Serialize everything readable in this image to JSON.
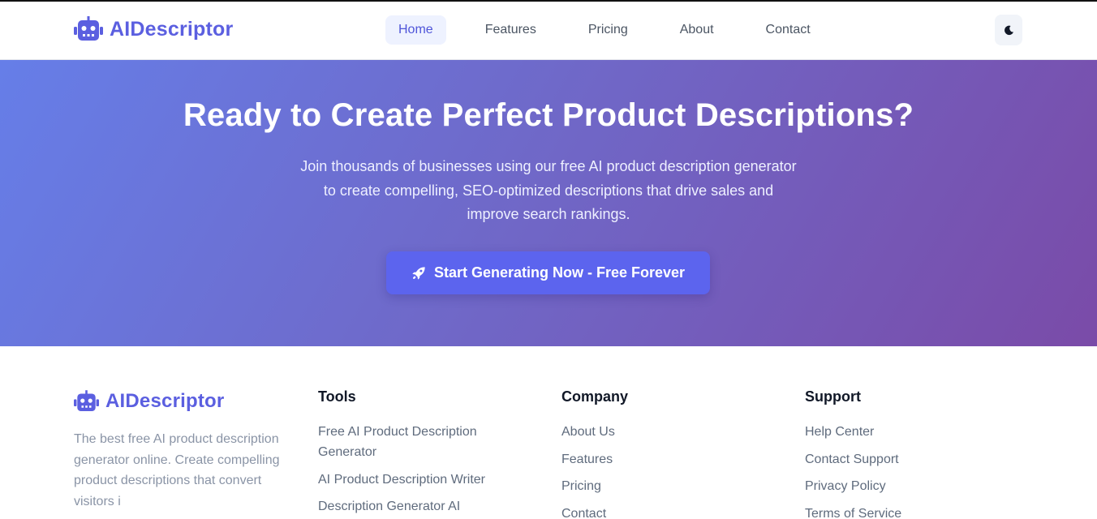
{
  "brand": {
    "name": "AIDescriptor",
    "icon": "robot-icon",
    "color": "#5b5fe0"
  },
  "nav": {
    "items": [
      {
        "label": "Home",
        "active": true
      },
      {
        "label": "Features",
        "active": false
      },
      {
        "label": "Pricing",
        "active": false
      },
      {
        "label": "About",
        "active": false
      },
      {
        "label": "Contact",
        "active": false
      }
    ],
    "theme_toggle_icon": "moon-icon"
  },
  "hero": {
    "title": "Ready to Create Perfect Product Descriptions?",
    "subtitle": "Join thousands of businesses using our free AI product description generator to create compelling, SEO-optimized descriptions that drive sales and improve search rankings.",
    "cta_label": "Start Generating Now - Free Forever",
    "cta_icon": "rocket-icon",
    "gradient": [
      "#667ee8",
      "#7a4ba8"
    ]
  },
  "footer": {
    "brand_name": "AIDescriptor",
    "description": "The best free AI product description generator online. Create compelling product descriptions that convert visitors i",
    "columns": [
      {
        "heading": "Tools",
        "links": [
          "Free AI Product Description Generator",
          "AI Product Description Writer",
          "Description Generator AI"
        ]
      },
      {
        "heading": "Company",
        "links": [
          "About Us",
          "Features",
          "Pricing",
          "Contact"
        ]
      },
      {
        "heading": "Support",
        "links": [
          "Help Center",
          "Contact Support",
          "Privacy Policy",
          "Terms of Service"
        ]
      }
    ]
  }
}
